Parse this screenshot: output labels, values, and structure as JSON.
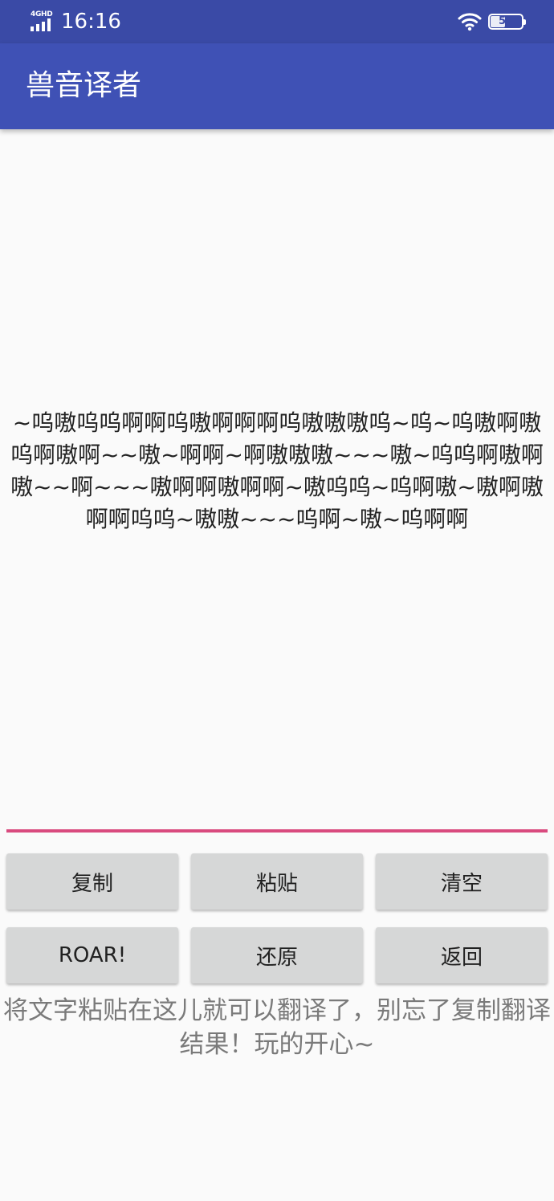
{
  "status_bar": {
    "network_label": "4GHD",
    "time": "16:16",
    "battery_level": 51,
    "battery_text": "51",
    "icons": [
      "signal-icon",
      "wifi-icon",
      "battery-icon"
    ]
  },
  "app_bar": {
    "title": "兽音译者"
  },
  "editor": {
    "text": "~呜嗷呜呜啊啊呜嗷啊啊啊呜嗷嗷嗷呜~呜~呜嗷啊嗷呜啊嗷啊~~嗷~啊啊~啊嗷嗷嗷~~~嗷~呜呜啊嗷啊嗷~~啊~~~嗷啊啊嗷啊啊~嗷呜呜~呜啊嗷~嗷啊嗷啊啊呜呜~嗷嗷~~~呜啊~嗷~呜啊啊"
  },
  "buttons": {
    "copy": "复制",
    "paste": "粘贴",
    "clear": "清空",
    "roar": "ROAR!",
    "restore": "还原",
    "back": "返回"
  },
  "hint": "将文字粘贴在这儿就可以翻译了，别忘了复制翻译结果！玩的开心~",
  "colors": {
    "status_bar": "#3a4aa6",
    "app_bar": "#3f51b5",
    "accent_underline": "#d94a7e",
    "button_bg": "#d6d7d7",
    "page_bg": "#fafafa"
  }
}
